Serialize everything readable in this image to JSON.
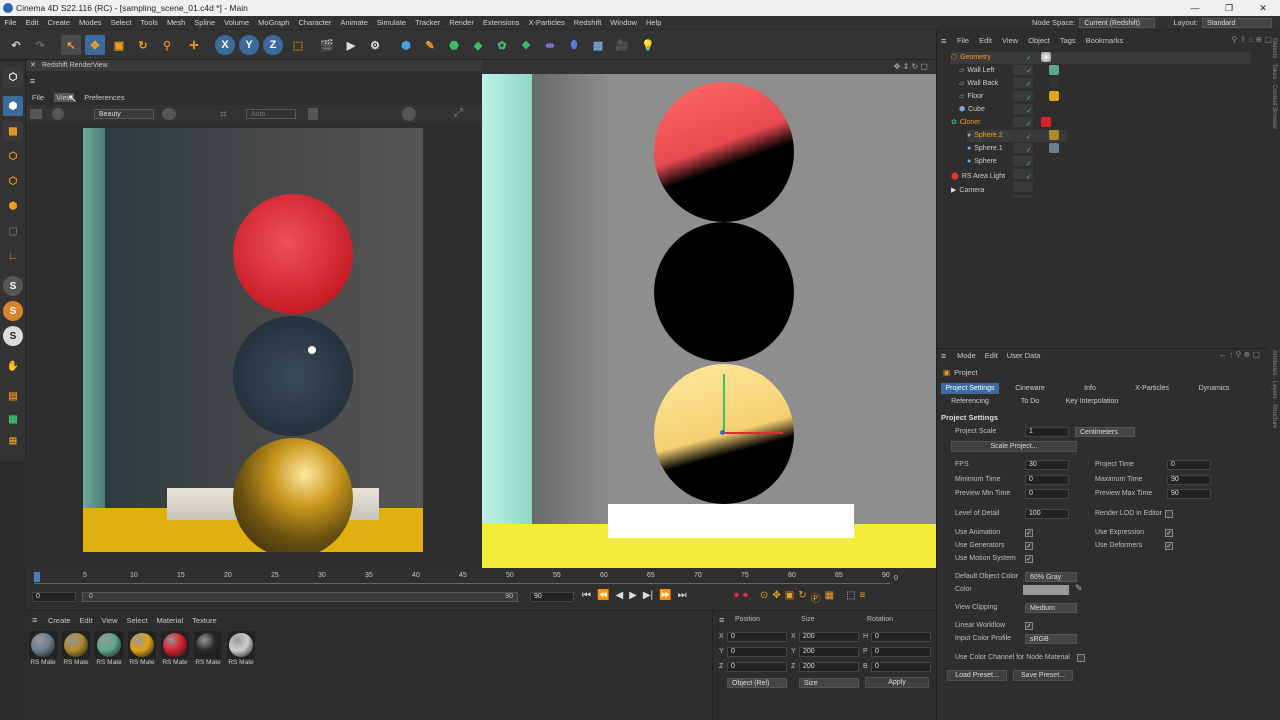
{
  "window": {
    "title": "Cinema 4D S22.116 (RC) - [sampling_scene_01.c4d *] - Main",
    "min": "—",
    "max": "❐",
    "close": "✕"
  },
  "menubar": {
    "items": [
      "File",
      "Edit",
      "Create",
      "Modes",
      "Select",
      "Tools",
      "Mesh",
      "Spline",
      "Volume",
      "MoGraph",
      "Character",
      "Animate",
      "Simulate",
      "Tracker",
      "Render",
      "Extensions",
      "X-Particles",
      "Redshift",
      "Window",
      "Help"
    ],
    "node_space_label": "Node Space:",
    "node_space_value": "Current (Redshift)",
    "layout_label": "Layout:",
    "layout_value": "Standard"
  },
  "toolbar": {
    "axis_x": "X",
    "axis_y": "Y",
    "axis_z": "Z"
  },
  "lefttools": {
    "s1": "S",
    "s2": "S",
    "s3": "S"
  },
  "renderview": {
    "title": "Redshift RenderView",
    "menu_file": "File",
    "menu_view": "View",
    "menu_prefs": "Preferences",
    "aov": "Beauty",
    "auto": "Auto"
  },
  "object_manager": {
    "menu": [
      "File",
      "Edit",
      "View",
      "Object",
      "Tags",
      "Bookmarks"
    ],
    "objects": [
      {
        "name": "Geometry"
      },
      {
        "name": "Wall Left"
      },
      {
        "name": "Wall Back"
      },
      {
        "name": "Floor"
      },
      {
        "name": "Cube"
      },
      {
        "name": "Cloner"
      },
      {
        "name": "Sphere.2"
      },
      {
        "name": "Sphere.1"
      },
      {
        "name": "Sphere"
      },
      {
        "name": "RS Area Light"
      },
      {
        "name": "Camera"
      }
    ]
  },
  "attributes": {
    "menu": [
      "Mode",
      "Edit",
      "User Data"
    ],
    "object": "Project",
    "tabs": [
      "Project Settings",
      "Cineware",
      "Info",
      "X-Particles",
      "Dynamics"
    ],
    "tabs2": [
      "Referencing",
      "To Do",
      "Key Interpolation"
    ],
    "section": "Project Settings",
    "project_scale_label": "Project Scale",
    "project_scale_value": "1",
    "project_scale_unit": "Centimeters",
    "scale_project_btn": "Scale Project...",
    "fps_label": "FPS",
    "fps": "30",
    "project_time_label": "Project Time",
    "project_time": "0",
    "min_time_label": "Minimum Time",
    "min_time": "0",
    "max_time_label": "Maximum Time",
    "max_time": "90",
    "prev_min_label": "Preview Min Time",
    "prev_min": "0",
    "prev_max_label": "Preview Max Time",
    "prev_max": "90",
    "lod_label": "Level of Detail",
    "lod": "100",
    "render_lod_label": "Render LOD in Editor",
    "use_anim_label": "Use Animation",
    "use_expr_label": "Use Expression",
    "use_gen_label": "Use Generators",
    "use_def_label": "Use Deformers",
    "use_motion_label": "Use Motion System",
    "def_color_label": "Default Object Color",
    "def_color_value": "60% Gray",
    "color_label": "Color",
    "view_clip_label": "View Clipping",
    "view_clip_value": "Medium",
    "linear_label": "Linear Workflow",
    "icp_label": "Input Color Profile",
    "icp_value": "sRGB",
    "node_mat_label": "Use Color Channel for Node Material",
    "load_preset": "Load Preset...",
    "save_preset": "Save Preset..."
  },
  "timeline": {
    "ticks": [
      "0",
      "5",
      "10",
      "15",
      "20",
      "25",
      "30",
      "35",
      "40",
      "45",
      "50",
      "55",
      "60",
      "65",
      "70",
      "75",
      "80",
      "85",
      "90"
    ],
    "current": "0",
    "start": "0",
    "range_start": "0",
    "range_end": "90",
    "end": "90",
    "frame_display": "0"
  },
  "materials": {
    "menu": [
      "Create",
      "Edit",
      "View",
      "Select",
      "Material",
      "Texture"
    ],
    "items": [
      {
        "label": "RS Mate",
        "color": "#6d7e8e"
      },
      {
        "label": "RS Mate",
        "color": "#b08a2a"
      },
      {
        "label": "RS Mate",
        "color": "#5fa88a"
      },
      {
        "label": "RS Mate",
        "color": "#e0a416"
      },
      {
        "label": "RS Mate",
        "color": "#d8222c"
      },
      {
        "label": "RS Mate",
        "color": "#2a2a2a"
      },
      {
        "label": "RS Mate",
        "color": "#cfcfcf"
      }
    ]
  },
  "coords": {
    "position": "Position",
    "size": "Size",
    "rotation": "Rotation",
    "x_label": "X",
    "y_label": "Y",
    "z_label": "Z",
    "px": "0",
    "py": "0",
    "pz": "0",
    "sx_label": "X",
    "sy_label": "Y",
    "sz_label": "Z",
    "sx": "200",
    "sy": "200",
    "sz": "200",
    "h_label": "H",
    "p_label": "P",
    "b_label": "B",
    "rh": "0",
    "rp": "0",
    "rb": "0",
    "mode": "Object (Rel)",
    "size_mode": "Size",
    "apply": "Apply"
  }
}
